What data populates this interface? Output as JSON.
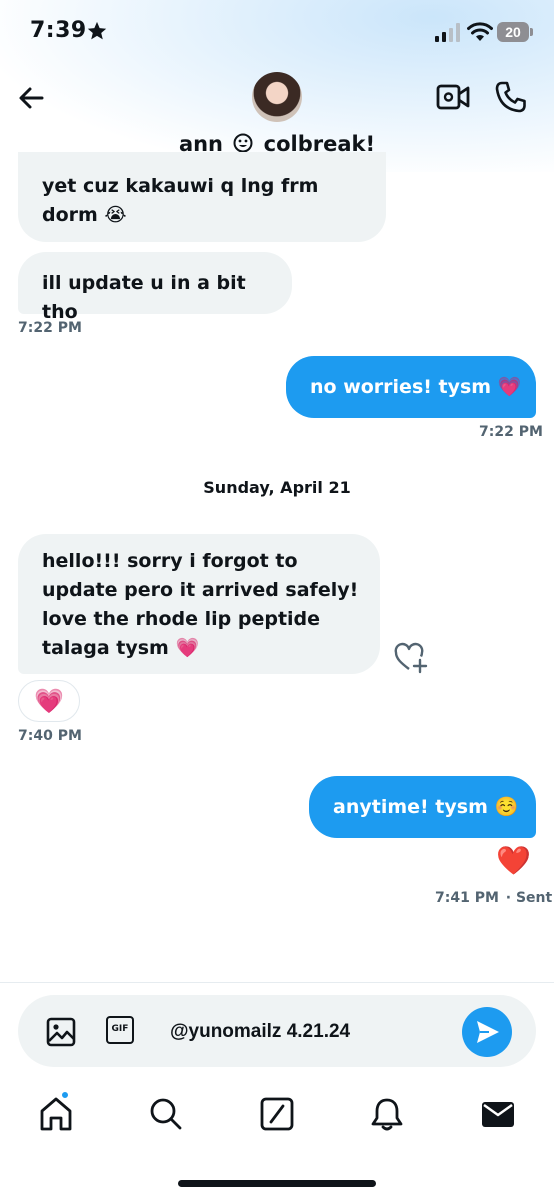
{
  "status_bar": {
    "time": "7:39",
    "battery": "20"
  },
  "header": {
    "name_part1": "ann",
    "name_part2": "colbreak!"
  },
  "messages": [
    {
      "direction": "in",
      "text": "yet cuz kakauwi q lng frm dorm 😭"
    },
    {
      "direction": "in",
      "text": "ill update u in a bit tho",
      "time": "7:22 PM"
    },
    {
      "direction": "out",
      "text": "no worries! tysm 💗",
      "time": "7:22 PM"
    },
    {
      "direction": "in",
      "text": "hello!!! sorry i forgot to update pero it arrived safely! love the rhode lip peptide talaga tysm 💗",
      "reaction": "💗",
      "time": "7:40 PM"
    },
    {
      "direction": "out",
      "text": "anytime! tysm ☺️",
      "reaction": "❤️",
      "time": "7:41 PM",
      "status": "· Sent"
    }
  ],
  "date_separator": "Sunday, April 21",
  "composer": {
    "gif_label": "GIF",
    "value": "@yunomailz 4.21.24"
  },
  "nav": [
    "home",
    "search",
    "compose",
    "notifications",
    "messages"
  ],
  "colors": {
    "accent": "#1d9bf0",
    "incoming_bubble": "#eff3f4",
    "text": "#0f1419",
    "muted": "#536471"
  }
}
